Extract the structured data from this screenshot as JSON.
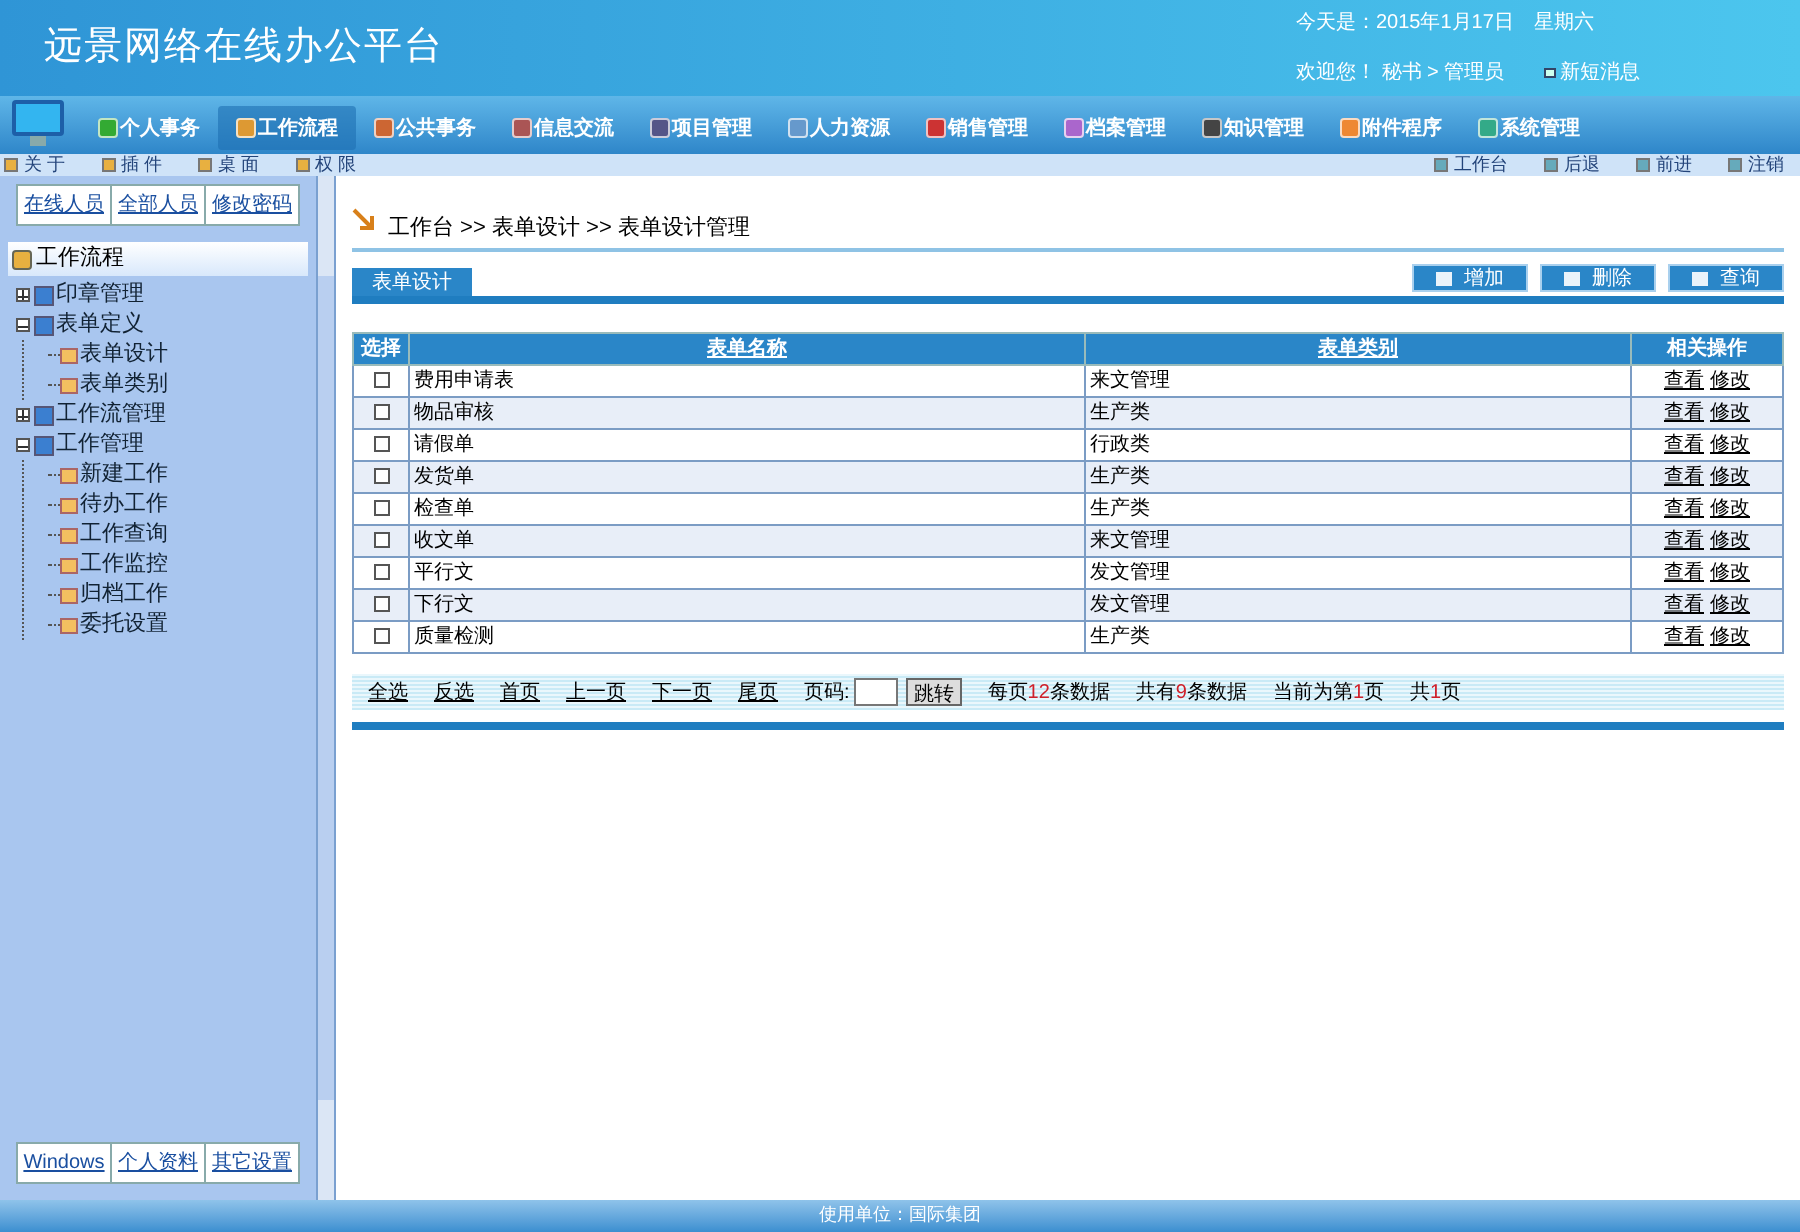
{
  "header": {
    "title": "远景网络在线办公平台",
    "date": "今天是：2015年1月17日　星期六",
    "welcome": "欢迎您！ 秘书 > 管理员",
    "messages": "新短消息"
  },
  "nav": [
    {
      "label": "个人事务",
      "selected": false
    },
    {
      "label": "工作流程",
      "selected": true
    },
    {
      "label": "公共事务",
      "selected": false
    },
    {
      "label": "信息交流",
      "selected": false
    },
    {
      "label": "项目管理",
      "selected": false
    },
    {
      "label": "人力资源",
      "selected": false
    },
    {
      "label": "销售管理",
      "selected": false
    },
    {
      "label": "档案管理",
      "selected": false
    },
    {
      "label": "知识管理",
      "selected": false
    },
    {
      "label": "附件程序",
      "selected": false
    },
    {
      "label": "系统管理",
      "selected": false
    }
  ],
  "toolbar_left": [
    "关 于",
    "插 件",
    "桌 面",
    "权 限"
  ],
  "toolbar_right": [
    "工作台",
    "后退",
    "前进",
    "注销"
  ],
  "sidebar": {
    "top_links": [
      "在线人员",
      "全部人员",
      "修改密码"
    ],
    "tree_title": "工作流程",
    "tree": [
      {
        "label": "印章管理",
        "expanded": false
      },
      {
        "label": "表单定义",
        "expanded": true,
        "children": [
          {
            "label": "表单设计"
          },
          {
            "label": "表单类别"
          }
        ]
      },
      {
        "label": "工作流管理",
        "expanded": false
      },
      {
        "label": "工作管理",
        "expanded": true,
        "children": [
          {
            "label": "新建工作"
          },
          {
            "label": "待办工作"
          },
          {
            "label": "工作查询"
          },
          {
            "label": "工作监控"
          },
          {
            "label": "归档工作"
          },
          {
            "label": "委托设置"
          }
        ]
      }
    ],
    "bottom_links": [
      "Windows",
      "个人资料",
      "其它设置"
    ]
  },
  "breadcrumb": "工作台 >> 表单设计 >> 表单设计管理",
  "section_tab": "表单设计",
  "actions": [
    "增加",
    "删除",
    "查询"
  ],
  "table": {
    "columns": [
      "选择",
      "表单名称",
      "表单类别",
      "相关操作"
    ],
    "rows": [
      {
        "checked": false,
        "name": "费用申请表",
        "category": "来文管理",
        "ops": [
          "查看",
          "修改"
        ]
      },
      {
        "checked": false,
        "name": "物品审核",
        "category": "生产类",
        "ops": [
          "查看",
          "修改"
        ]
      },
      {
        "checked": false,
        "name": "请假单",
        "category": "行政类",
        "ops": [
          "查看",
          "修改"
        ]
      },
      {
        "checked": false,
        "name": "发货单",
        "category": "生产类",
        "ops": [
          "查看",
          "修改"
        ]
      },
      {
        "checked": false,
        "name": "检查单",
        "category": "生产类",
        "ops": [
          "查看",
          "修改"
        ]
      },
      {
        "checked": false,
        "name": "收文单",
        "category": "来文管理",
        "ops": [
          "查看",
          "修改"
        ]
      },
      {
        "checked": false,
        "name": "平行文",
        "category": "发文管理",
        "ops": [
          "查看",
          "修改"
        ]
      },
      {
        "checked": false,
        "name": "下行文",
        "category": "发文管理",
        "ops": [
          "查看",
          "修改"
        ]
      },
      {
        "checked": false,
        "name": "质量检测",
        "category": "生产类",
        "ops": [
          "查看",
          "修改"
        ]
      }
    ]
  },
  "pager": {
    "links": [
      "全选",
      "反选",
      "首页",
      "上一页",
      "下一页",
      "尾页"
    ],
    "page_label": "页码:",
    "go": "跳转",
    "stats": [
      {
        "pre": "每页",
        "num": "12",
        "post": "条数据"
      },
      {
        "pre": "共有",
        "num": "9",
        "post": "条数据"
      },
      {
        "pre": "当前为第",
        "num": "1",
        "post": "页"
      },
      {
        "pre": "共",
        "num": "1",
        "post": "页"
      }
    ]
  },
  "footer": "使用单位：国际集团"
}
